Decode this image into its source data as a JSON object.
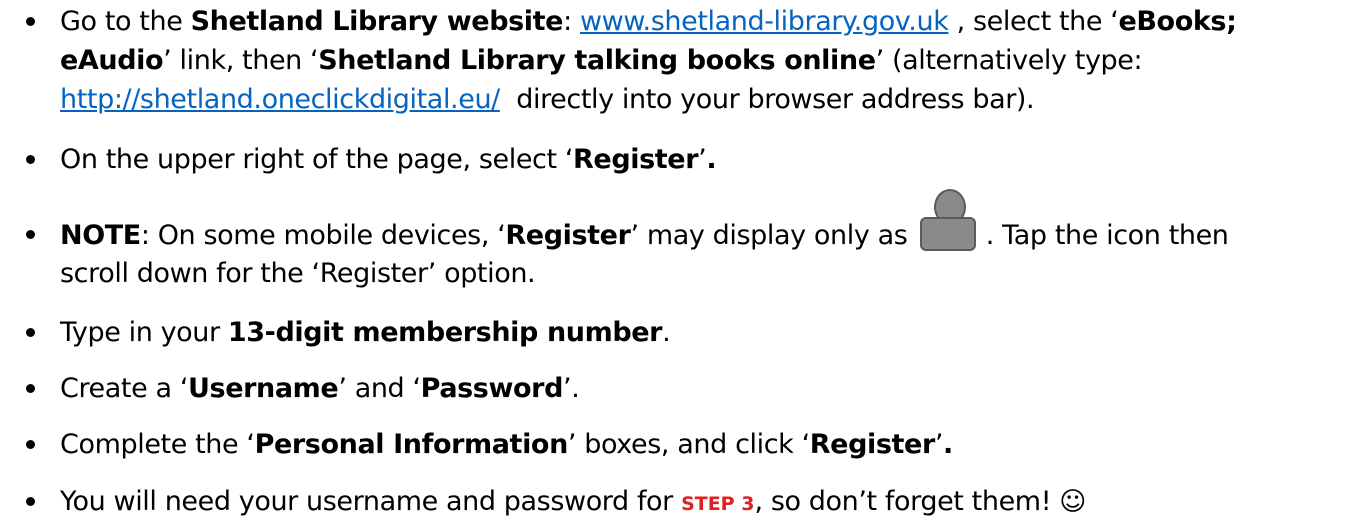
{
  "bullets": [
    {
      "line1": {
        "t1": "Go to the ",
        "b1": "Shetland Library website",
        "t2": ": ",
        "link1": "www.shetland-library.gov.uk",
        "t3": " , select the ‘",
        "b2": "eBooks;"
      },
      "line2": {
        "b1": "eAudio",
        "t1": "’ link, then ‘",
        "b2": "Shetland Library talking books online",
        "t2": "’ (alternatively type:"
      },
      "line3": {
        "link1": "http://shetland.oneclickdigital.eu/",
        "t1": "  directly into your browser address bar)."
      }
    },
    {
      "line1": {
        "t1": "On the upper right of the page, select ‘",
        "b1": "Register",
        "t2": "’",
        "b2": "."
      }
    },
    {
      "line1": {
        "b1": "NOTE",
        "t1": ": On some mobile devices, ‘",
        "b2": "Register",
        "t2": "’ may display only as ",
        "icon": "user-icon",
        "t3": " . Tap the icon then"
      },
      "line2": {
        "t1": "scroll down for the ‘Register’ option."
      }
    },
    {
      "line1": {
        "t1": "Type in your ",
        "b1": "13-digit membership number",
        "t2": "."
      }
    },
    {
      "line1": {
        "t1": "Create a ‘",
        "b1": "Username",
        "t2": "’ and ‘",
        "b2": "Password",
        "t3": "’."
      }
    },
    {
      "line1": {
        "t1": "Complete the ‘",
        "b1": "Personal Information",
        "t2": "’ boxes, and click ‘",
        "b2": "Register",
        "t3": "’",
        "b3": "."
      }
    },
    {
      "line1": {
        "t1": "You will need your username and password for ",
        "step": "STEP 3",
        "t2": ", so don’t forget them! ",
        "smiley": "☺"
      }
    }
  ],
  "colors": {
    "link": "#0563c1",
    "step": "#e02020",
    "icon_fill": "#8a8a8a"
  }
}
